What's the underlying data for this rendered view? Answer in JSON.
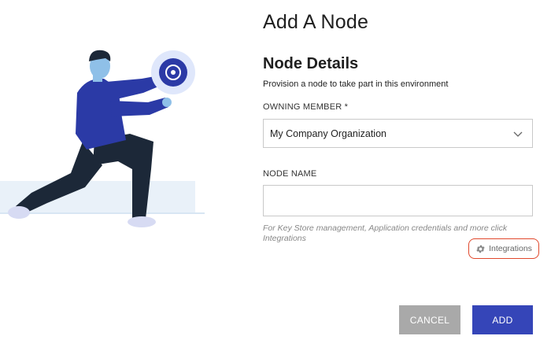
{
  "modal": {
    "title": "Add A Node"
  },
  "section": {
    "title": "Node Details",
    "description": "Provision a node to take part in this environment"
  },
  "owning_member": {
    "label": "OWNING MEMBER *",
    "selected": "My Company Organization"
  },
  "node_name": {
    "label": "NODE NAME",
    "value": "",
    "placeholder": ""
  },
  "hint": "For Key Store management, Application credentials and more click Integrations",
  "integrations": {
    "label": "Integrations",
    "icon": "gear-icon"
  },
  "actions": {
    "cancel_label": "CANCEL",
    "add_label": "ADD"
  },
  "colors": {
    "primary": "#3545b8",
    "cancel": "#a9a9a9",
    "highlight": "#e0482c",
    "figure_shirt": "#2b3aa6",
    "figure_pants": "#1c2838"
  }
}
